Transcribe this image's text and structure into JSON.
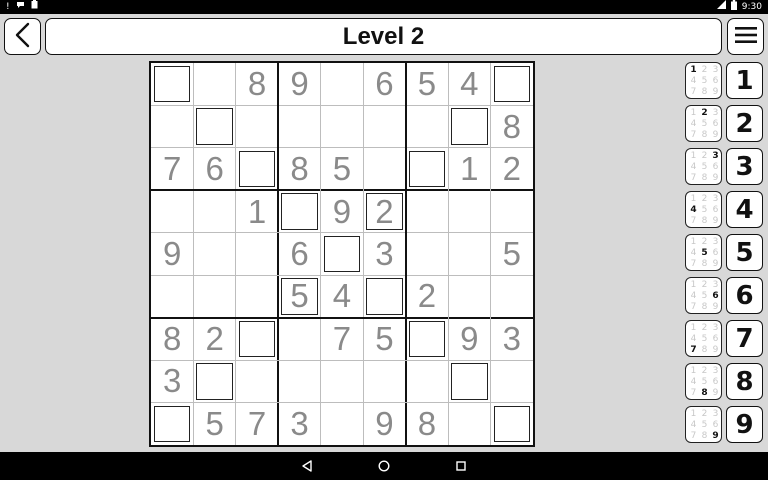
{
  "status_bar": {
    "time": "9:30",
    "icons_left": [
      "alert-icon",
      "chat-icon",
      "clipboard-icon"
    ],
    "icons_right": [
      "signal-icon",
      "battery-icon"
    ]
  },
  "header": {
    "title": "Level 2",
    "back_icon": "chevron-left-icon",
    "menu_icon": "hamburger-menu-icon"
  },
  "board": {
    "grid": [
      [
        " ",
        "",
        "8",
        "9",
        "",
        "6",
        "5",
        "4",
        " "
      ],
      [
        "",
        " ",
        "",
        "",
        "",
        "",
        "",
        " ",
        "8"
      ],
      [
        "7",
        "6",
        " ",
        "8",
        "5",
        "",
        " ",
        "1",
        "2"
      ],
      [
        "",
        "",
        "1",
        " ",
        "9",
        "2",
        "",
        "",
        ""
      ],
      [
        "9",
        "",
        "",
        "6",
        " ",
        "3",
        "",
        "",
        "5"
      ],
      [
        "",
        "",
        "",
        "5",
        "4",
        " ",
        "2",
        "",
        ""
      ],
      [
        "8",
        "2",
        " ",
        "",
        "7",
        "5",
        " ",
        "9",
        "3"
      ],
      [
        "3",
        " ",
        "",
        "",
        "",
        "",
        "",
        " ",
        ""
      ],
      [
        " ",
        "5",
        "7",
        "3",
        "",
        "9",
        "8",
        "",
        " "
      ]
    ],
    "highlighted": [
      [
        0,
        0
      ],
      [
        0,
        8
      ],
      [
        1,
        1
      ],
      [
        1,
        7
      ],
      [
        2,
        2
      ],
      [
        2,
        6
      ],
      [
        3,
        3
      ],
      [
        3,
        5
      ],
      [
        4,
        4
      ],
      [
        5,
        3
      ],
      [
        5,
        5
      ],
      [
        6,
        2
      ],
      [
        6,
        6
      ],
      [
        7,
        1
      ],
      [
        7,
        7
      ],
      [
        8,
        0
      ],
      [
        8,
        8
      ]
    ]
  },
  "palette": {
    "numbers": [
      "1",
      "2",
      "3",
      "4",
      "5",
      "6",
      "7",
      "8",
      "9"
    ],
    "pencil_digits": [
      "1",
      "2",
      "3",
      "4",
      "5",
      "6",
      "7",
      "8",
      "9"
    ]
  },
  "nav_bar": {
    "icons": [
      "back-triangle-icon",
      "home-circle-icon",
      "recents-square-icon"
    ]
  }
}
